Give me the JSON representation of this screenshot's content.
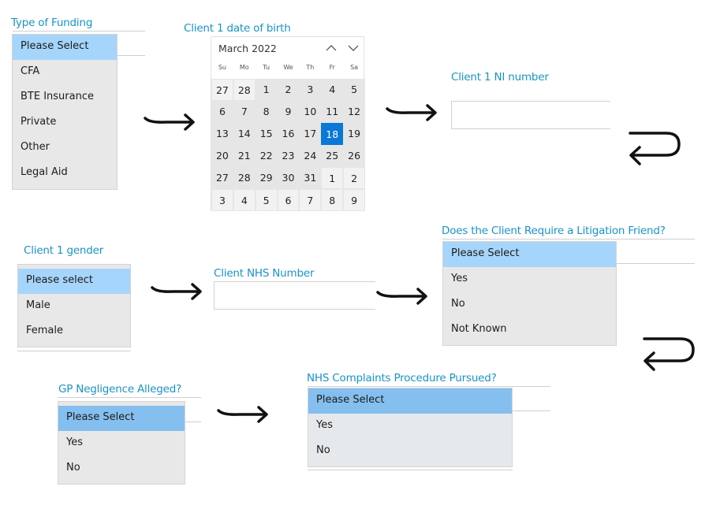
{
  "funding": {
    "label": "Type of Funding",
    "options": [
      "Please Select",
      "CFA",
      "BTE Insurance",
      "Private",
      "Other",
      "Legal Aid"
    ],
    "selected": "Please Select"
  },
  "dob": {
    "label": "Client 1 date of birth",
    "month_title": "March 2022",
    "prev_icon": "chevron-up-icon",
    "next_icon": "chevron-down-icon",
    "weekdays": [
      "Su",
      "Mo",
      "Tu",
      "We",
      "Th",
      "Fr",
      "Sa"
    ],
    "weeks": [
      [
        "27",
        "28",
        "1",
        "2",
        "3",
        "4",
        "5"
      ],
      [
        "6",
        "7",
        "8",
        "9",
        "10",
        "11",
        "12"
      ],
      [
        "13",
        "14",
        "15",
        "16",
        "17",
        "18",
        "19"
      ],
      [
        "20",
        "21",
        "22",
        "23",
        "24",
        "25",
        "26"
      ],
      [
        "27",
        "28",
        "29",
        "30",
        "31",
        "1",
        "2"
      ],
      [
        "3",
        "4",
        "5",
        "6",
        "7",
        "8",
        "9"
      ]
    ],
    "selected_day": "18"
  },
  "ni": {
    "label": "Client 1 NI number",
    "value": ""
  },
  "gender": {
    "label": "Client 1 gender",
    "options": [
      "Please select",
      "Male",
      "Female"
    ],
    "selected": "Please select"
  },
  "nhs_number": {
    "label": "Client NHS Number",
    "value": ""
  },
  "litigation": {
    "label": "Does the Client Require a Litigation Friend?",
    "options": [
      "Please Select",
      "Yes",
      "No",
      "Not Known"
    ],
    "selected": "Please Select"
  },
  "gp": {
    "label": "GP Negligence Alleged?",
    "options": [
      "Please Select",
      "Yes",
      "No"
    ],
    "selected": "Please Select"
  },
  "complaints": {
    "label": "NHS Complaints Procedure Pursued?",
    "options": [
      "Please Select",
      "Yes",
      "No"
    ],
    "selected": "Please Select"
  },
  "colors": {
    "label": "#1a93c6",
    "selected_option": "#a6d5fb",
    "today": "#0a78d7"
  }
}
